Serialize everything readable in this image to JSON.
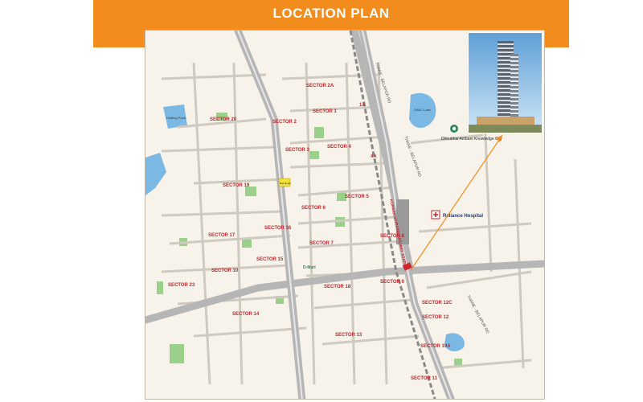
{
  "header": {
    "title": "LOCATION PLAN"
  },
  "colors": {
    "banner": "#f28c1c",
    "map_bg": "#f7f3ea",
    "road": "#c9c9c9",
    "major_road": "#a9a9a9",
    "water": "#7bb8e3",
    "park": "#9bd08a",
    "sector_label": "#c0262d",
    "pointer": "#f28c1c"
  },
  "sectors": [
    "SECTOR 1",
    "SECTOR 2",
    "SECTOR 2A",
    "SECTOR 3",
    "SECTOR 4",
    "1A",
    "4A",
    "SECTOR 5",
    "SECTOR 6",
    "SECTOR 7",
    "SECTOR 8",
    "SECTOR 9",
    "SECTOR 10",
    "SECTOR 11",
    "SECTOR 12",
    "SECTOR 12C",
    "SECTOR 13",
    "SECTOR 14",
    "SECTOR 15",
    "SECTOR 16",
    "SECTOR 17",
    "SECTOR 18",
    "SECTOR 19",
    "SECTOR 19A",
    "SECTOR 20",
    "SECTOR 23"
  ],
  "roads": [
    "THANE - BELAPUR RD",
    "THANE - BELAPUR RD",
    "THANE - BELAPUR RD"
  ],
  "station_label": "KOPARKHAIRANE RAILWAY STATION",
  "landmarks": {
    "dhirubhai": "Dhirubhai Ambani Knowledge City",
    "reliance": "Reliance Hospital",
    "dmart": "D-Mart",
    "bus_depot": "Bus Depot",
    "dakc_lake": "DAKC Lake",
    "holding_pond": "Holding Pond"
  },
  "icons": {
    "hospital": "hospital-icon",
    "location": "location-pin-icon",
    "site": "site-marker-icon"
  }
}
